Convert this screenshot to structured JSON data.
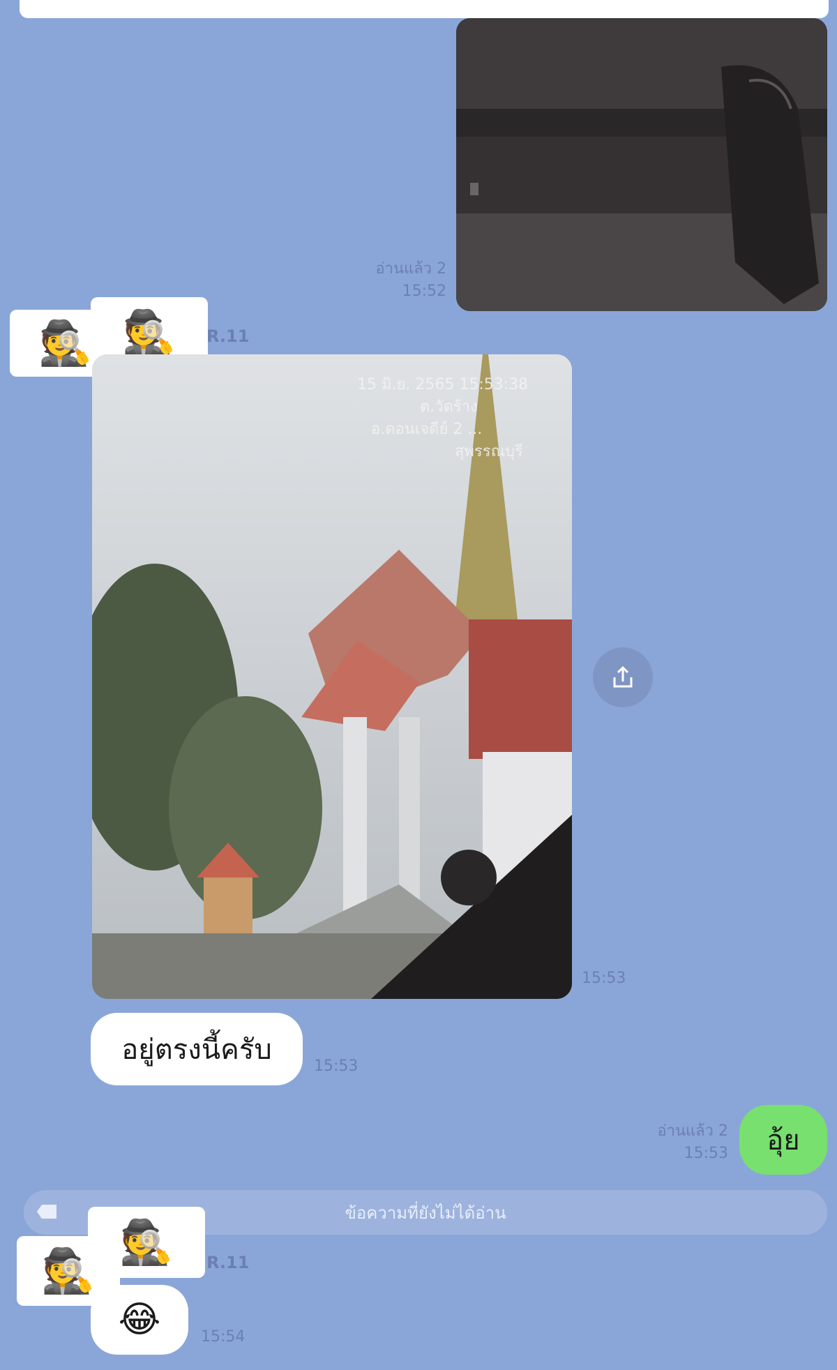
{
  "messages": {
    "photo1": {
      "read_label": "อ่านแล้ว 2",
      "time": "15:52"
    },
    "sender1": {
      "name": "R.11",
      "stickers": [
        "🕵️",
        "🕵️"
      ]
    },
    "photo2": {
      "overlay_lines": [
        "15 มิ.ย. 2565 15:53:38",
        "ต.วัดร้าง",
        "อ.ดอนเจดีย์ 2 ...",
        "สุพรรณบุรี"
      ],
      "time": "15:53"
    },
    "text1": {
      "text": "อยู่ตรงนี้ครับ",
      "time": "15:53"
    },
    "own_reply": {
      "read_label": "อ่านแล้ว 2",
      "time": "15:53",
      "text": "อุ้ย"
    },
    "unread_divider": {
      "text": "ข้อความที่ยังไม่ได้อ่าน"
    },
    "sender2": {
      "name": "R.11",
      "stickers": [
        "🕵️",
        "🕵️"
      ]
    },
    "emoji_msg": {
      "emoji": "😂",
      "time": "15:54"
    }
  },
  "colors": {
    "chat_bg": "#8aa6d8",
    "own_bubble": "#78e06f",
    "bubble": "#ffffff",
    "meta_text": "#6b7fb2"
  },
  "icons": {
    "share": "share-icon",
    "unread": "unread-marker-icon"
  }
}
